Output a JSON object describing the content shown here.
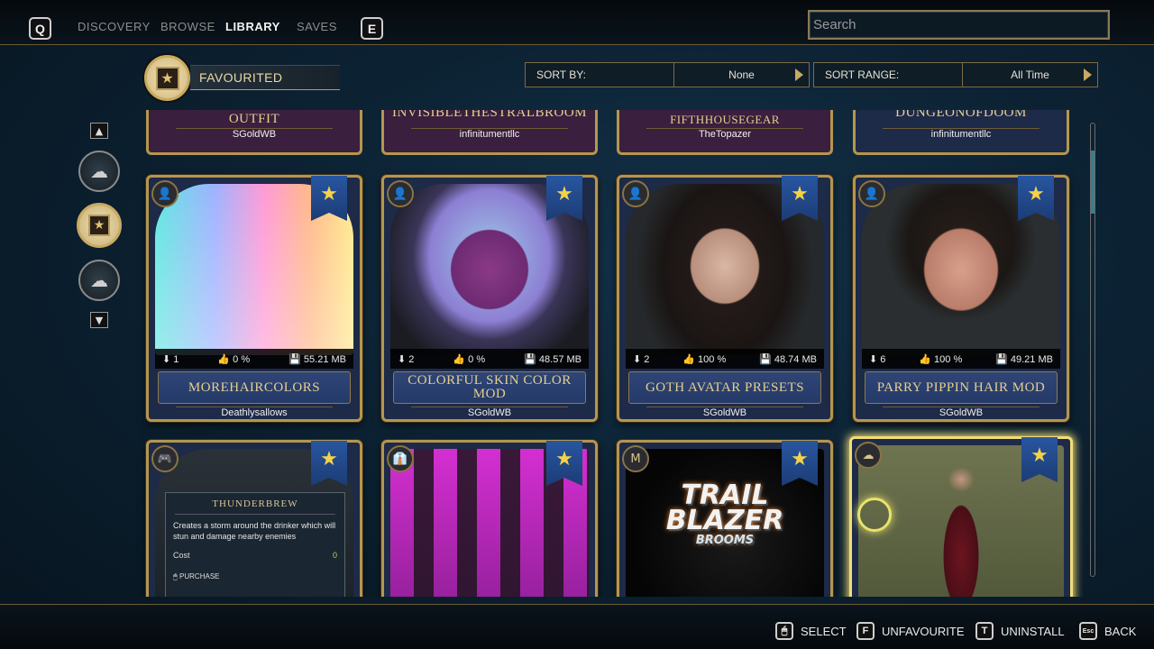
{
  "topnav": {
    "left_key": "Q",
    "right_key": "E",
    "tabs": [
      {
        "label": "DISCOVERY",
        "active": false
      },
      {
        "label": "BROWSE",
        "active": false
      },
      {
        "label": "LIBRARY",
        "active": true
      },
      {
        "label": "SAVES",
        "active": false
      }
    ],
    "search_placeholder": "Search"
  },
  "header": {
    "filter_label": "FAVOURITED",
    "sort_by": {
      "label": "SORT BY:",
      "value": "None"
    },
    "sort_range": {
      "label": "SORT RANGE:",
      "value": "All Time"
    }
  },
  "top_row_partial": [
    {
      "title": "NORA TREADWELL OUTFIT",
      "author": "SGoldWB"
    },
    {
      "title": "INVISIBLETHESTRALBROOM",
      "author": "infinitumentllc"
    },
    {
      "title": "COLLECTION: GEAR FIFTHHOUSEGEAR",
      "author": "TheTopazer"
    },
    {
      "title": "DUNGEONOFDOOM",
      "author": "infinitumentllc"
    }
  ],
  "mods": [
    {
      "title": "MOREHAIRCOLORS",
      "author": "Deathlysallows",
      "downloads": "1",
      "likes": "0 %",
      "size": "55.21 MB"
    },
    {
      "title": "COLORFUL SKIN COLOR MOD",
      "author": "SGoldWB",
      "downloads": "2",
      "likes": "0 %",
      "size": "48.57 MB"
    },
    {
      "title": "GOTH AVATAR PRESETS",
      "author": "SGoldWB",
      "downloads": "2",
      "likes": "100 %",
      "size": "48.74 MB"
    },
    {
      "title": "PARRY PIPPIN HAIR MOD",
      "author": "SGoldWB",
      "downloads": "6",
      "likes": "100 %",
      "size": "49.21 MB"
    }
  ],
  "bottom_row": {
    "thunderbrew": {
      "title": "THUNDERBREW",
      "description": "Creates a storm around the drinker which will stun and damage nearby enemies",
      "cost_label": "Cost",
      "cost_value": "0",
      "purchase": "PURCHASE"
    },
    "trailblazer_line1": "TRAIL",
    "trailblazer_line2": "BLAZER",
    "trailblazer_line3": "BROOMS",
    "m_badge": "M"
  },
  "actions": [
    {
      "key": "🖱",
      "label": "SELECT"
    },
    {
      "key": "F",
      "label": "UNFAVOURITE"
    },
    {
      "key": "T",
      "label": "UNINSTALL"
    },
    {
      "key": "Esc",
      "label": "BACK"
    }
  ],
  "colors": {
    "gold": "#b5964f",
    "card_blue": "#1d2a48",
    "card_purple": "#3a1f3e",
    "ribbon_blue": "#2856a0",
    "star_yellow": "#f4d24a"
  }
}
